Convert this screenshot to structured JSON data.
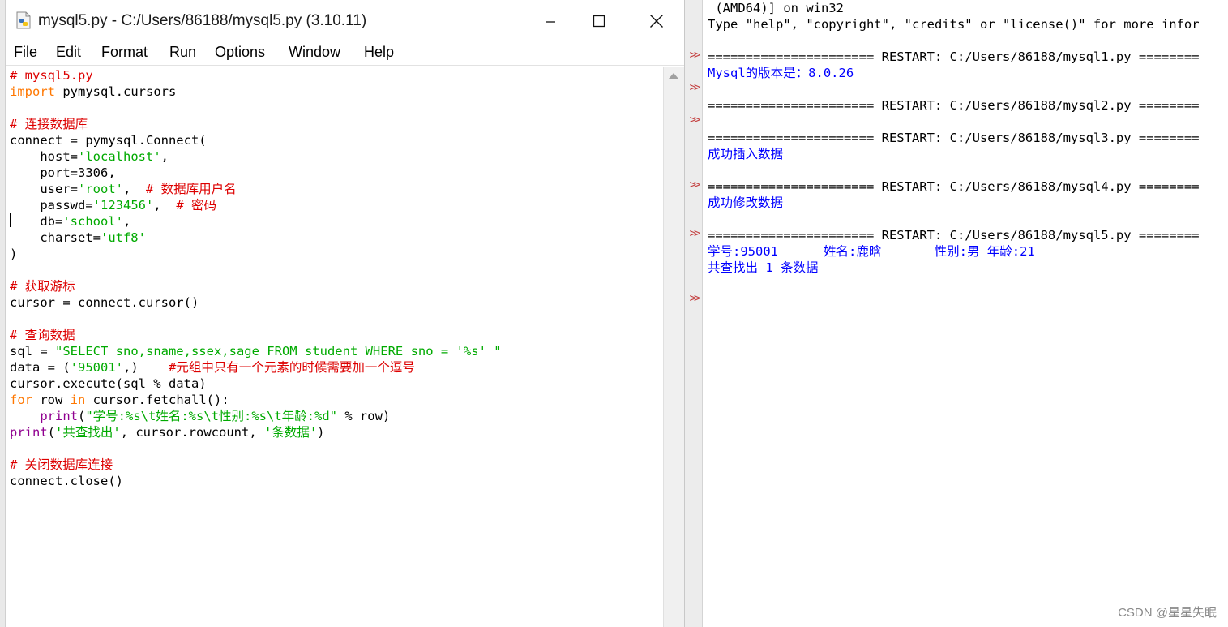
{
  "editor": {
    "title": "mysql5.py - C:/Users/86188/mysql5.py (3.10.11)",
    "menu": [
      "File",
      "Edit",
      "Format",
      "Run",
      "Options",
      "Window",
      "Help"
    ],
    "lines": [
      [
        {
          "t": "# mysql5.py",
          "c": "comment"
        }
      ],
      [
        {
          "t": "import",
          "c": "kw"
        },
        {
          "t": " pymysql.cursors",
          "c": "normal"
        }
      ],
      [],
      [
        {
          "t": "# 连接数据库",
          "c": "comment"
        }
      ],
      [
        {
          "t": "connect = pymysql.Connect(",
          "c": "normal"
        }
      ],
      [
        {
          "t": "    host=",
          "c": "normal"
        },
        {
          "t": "'localhost'",
          "c": "str"
        },
        {
          "t": ",",
          "c": "normal"
        }
      ],
      [
        {
          "t": "    port=3306,",
          "c": "normal"
        }
      ],
      [
        {
          "t": "    user=",
          "c": "normal"
        },
        {
          "t": "'root'",
          "c": "str"
        },
        {
          "t": ",  ",
          "c": "normal"
        },
        {
          "t": "# 数据库用户名",
          "c": "comment"
        }
      ],
      [
        {
          "t": "    passwd=",
          "c": "normal"
        },
        {
          "t": "'123456'",
          "c": "str"
        },
        {
          "t": ",  ",
          "c": "normal"
        },
        {
          "t": "# 密码",
          "c": "comment"
        }
      ],
      [
        {
          "t": "    db=",
          "c": "normal"
        },
        {
          "t": "'school'",
          "c": "str"
        },
        {
          "t": ",",
          "c": "normal"
        }
      ],
      [
        {
          "t": "    charset=",
          "c": "normal"
        },
        {
          "t": "'utf8'",
          "c": "str"
        }
      ],
      [
        {
          "t": ")",
          "c": "normal"
        }
      ],
      [],
      [
        {
          "t": "# 获取游标",
          "c": "comment"
        }
      ],
      [
        {
          "t": "cursor = connect.cursor()",
          "c": "normal"
        }
      ],
      [],
      [
        {
          "t": "# 查询数据",
          "c": "comment"
        }
      ],
      [
        {
          "t": "sql = ",
          "c": "normal"
        },
        {
          "t": "\"SELECT sno,sname,ssex,sage FROM student WHERE sno = '%s' \"",
          "c": "str"
        }
      ],
      [
        {
          "t": "data = (",
          "c": "normal"
        },
        {
          "t": "'95001'",
          "c": "str"
        },
        {
          "t": ",)    ",
          "c": "normal"
        },
        {
          "t": "#元组中只有一个元素的时候需要加一个逗号",
          "c": "comment"
        }
      ],
      [
        {
          "t": "cursor.execute(sql % data)",
          "c": "normal"
        }
      ],
      [
        {
          "t": "for",
          "c": "kw"
        },
        {
          "t": " row ",
          "c": "normal"
        },
        {
          "t": "in",
          "c": "kw"
        },
        {
          "t": " cursor.fetchall():",
          "c": "normal"
        }
      ],
      [
        {
          "t": "    ",
          "c": "normal"
        },
        {
          "t": "print",
          "c": "builtin"
        },
        {
          "t": "(",
          "c": "normal"
        },
        {
          "t": "\"学号:%s\\t姓名:%s\\t性别:%s\\t年龄:%d\"",
          "c": "str"
        },
        {
          "t": " % row)",
          "c": "normal"
        }
      ],
      [
        {
          "t": "print",
          "c": "builtin"
        },
        {
          "t": "(",
          "c": "normal"
        },
        {
          "t": "'共查找出'",
          "c": "str"
        },
        {
          "t": ", cursor.rowcount, ",
          "c": "normal"
        },
        {
          "t": "'条数据'",
          "c": "str"
        },
        {
          "t": ")",
          "c": "normal"
        }
      ],
      [],
      [
        {
          "t": "# 关闭数据库连接",
          "c": "comment"
        }
      ],
      [
        {
          "t": "connect.close()",
          "c": "normal"
        }
      ]
    ]
  },
  "shell": {
    "prompt": ">>",
    "lines": [
      {
        "t": " (AMD64)] on win32",
        "c": "normal"
      },
      {
        "t": "Type \"help\", \"copyright\", \"credits\" or \"license()\" for more infor",
        "c": "normal"
      },
      {
        "t": "",
        "c": "normal"
      },
      {
        "t": "====================== RESTART: C:/Users/86188/mysql1.py ========",
        "c": "normal"
      },
      {
        "t": "Mysql的版本是：8.0.26",
        "c": "out"
      },
      {
        "t": "",
        "c": "normal"
      },
      {
        "t": "====================== RESTART: C:/Users/86188/mysql2.py ========",
        "c": "normal"
      },
      {
        "t": "",
        "c": "normal"
      },
      {
        "t": "====================== RESTART: C:/Users/86188/mysql3.py ========",
        "c": "normal"
      },
      {
        "t": "成功插入数据",
        "c": "out"
      },
      {
        "t": "",
        "c": "normal"
      },
      {
        "t": "====================== RESTART: C:/Users/86188/mysql4.py ========",
        "c": "normal"
      },
      {
        "t": "成功修改数据",
        "c": "out"
      },
      {
        "t": "",
        "c": "normal"
      },
      {
        "t": "====================== RESTART: C:/Users/86188/mysql5.py ========",
        "c": "normal"
      },
      {
        "t": "学号:95001      姓名:鹿晗       性别:男 年龄:21",
        "c": "out"
      },
      {
        "t": "共查找出 1 条数据",
        "c": "out"
      }
    ],
    "prompt_rows": [
      2,
      4,
      6,
      10,
      13,
      17
    ]
  },
  "watermark": "CSDN @星星失眠"
}
